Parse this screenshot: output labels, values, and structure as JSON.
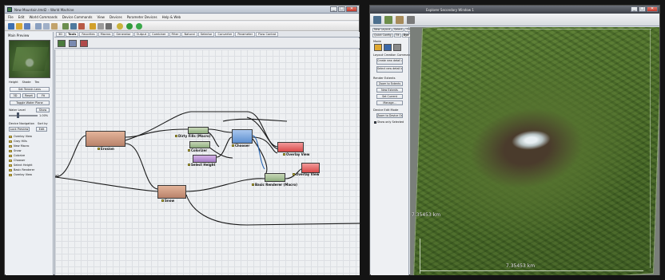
{
  "window1": {
    "title": "New Mountain.tmd2 – World Machine",
    "menu": [
      "File",
      "Edit",
      "World Commands",
      "Device Commands",
      "View",
      "Devices",
      "Parameter Devices",
      "Help & Web"
    ],
    "left_panel": {
      "header": "Main Preview",
      "view_modes": [
        "Height",
        "Shade",
        "Tex"
      ],
      "buttons": {
        "set_terrain": "Set Terrain Lens",
        "toggle_water": "Toggle Water Plane",
        "show": "Show",
        "lock_preview": "Lock Preview",
        "edit": "Edit"
      },
      "small_buttons": [
        "3D",
        "Reset",
        "Fit"
      ],
      "water_level_label": "Water Level",
      "water_value": "1.00%",
      "device_nav_label": "Device Navigation",
      "sort_label": "Sort by",
      "devices": [
        "Overlay View",
        "Gray Hills",
        "New Macro",
        "Snow",
        "Colorize",
        "Chooser",
        "Select Height",
        "Basic Renderer",
        "Overlay View"
      ]
    },
    "tabs": [
      "3D",
      "Tools",
      "Favorites",
      "Macros",
      "Generator",
      "Output",
      "Combiner",
      "Filter",
      "Natural",
      "Selector",
      "Converter",
      "Parameter",
      "Flow Control"
    ],
    "active_tab": "Tools",
    "nodes": {
      "erosion": "Erosion",
      "dirty_fills": "Dirty Fills (Macro)",
      "colorizer": "Colorizer",
      "chooser": "Chooser",
      "select_height": "Select Height",
      "snow": "Snow",
      "overlay1": "Overlay View",
      "overlay2": "Overlay View",
      "basic_renderer": "Basic Renderer (Macro)",
      "left_edge": "a)"
    }
  },
  "window2": {
    "title": "Explorer Secondary Window 1",
    "top_buttons": [
      "New Layout",
      "Select",
      "Overview"
    ],
    "tabs": [
      "Quick Config",
      "Tilt",
      "Eye",
      "Sun",
      "Render"
    ],
    "sections": {
      "mode": "Mode",
      "layout_creation": "Layout Creation Commands",
      "cmd1": "Create new detail at Active Layer",
      "cmd2": "Select new detail by height adjustment",
      "render_extents": "Render Extents",
      "zoom_extents": "Zoom to Extents",
      "new_extents": "New Extents",
      "set_current": "Set Current",
      "manage": "Manage...",
      "device_edit_mode": "Device Edit Mode",
      "zoom_selected": "Zoom to Device Origin",
      "show_selected": "Show only Selected"
    },
    "scale_vertical": "7.35453 km",
    "scale_horizontal": "7.35453 km"
  }
}
